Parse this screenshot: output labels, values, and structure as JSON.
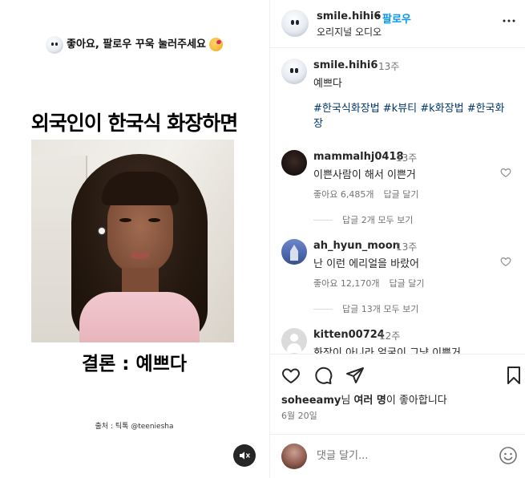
{
  "media": {
    "top_text": "좋아요, 팔로우 꾸욱 눌러주세요",
    "headline": "외국인이 한국식 화장하면",
    "conclusion": "결론 : 예쁘다",
    "source": "출처 : 틱톡 @teeniesha"
  },
  "post": {
    "username": "smile.hihi6",
    "separator": "•",
    "follow_label": "팔로우",
    "audio_label": "오리지널 오디오"
  },
  "caption": {
    "username": "smile.hihi6",
    "time": "13주",
    "text": "예쁘다",
    "hashtags": "#한국식화장법 #k뷰티 #k화장법 #한국화장"
  },
  "comments": [
    {
      "username": "mammalhj0418",
      "time": "13주",
      "text": "이쁜사람이 해서 이쁜거",
      "likes": "좋아요 6,485개",
      "reply": "답글 달기",
      "view_replies": "답글 2개 모두 보기"
    },
    {
      "username": "ah_hyun_moon",
      "time": "13주",
      "text": "난 이런 에리얼을 바랐어",
      "likes": "좋아요 12,170개",
      "reply": "답글 달기",
      "view_replies": "답글 13개 모두 보기"
    },
    {
      "username": "kitten00724",
      "time": "12주",
      "text": "화장이 아니라 얼굴이 그냥 이쁜거"
    }
  ],
  "likes_summary": {
    "user": "soheeamy",
    "suffix_1": "님 ",
    "others": "여러 명",
    "suffix_2": "이 좋아합니다"
  },
  "date": "6월 20일",
  "composer": {
    "placeholder": "댓글 달기..."
  },
  "icons": {
    "like": "heart-icon",
    "comment": "comment-bubble-icon",
    "share": "paper-plane-icon",
    "save": "bookmark-icon",
    "more": "more-dots-icon",
    "mute": "speaker-muted-icon",
    "emoji": "emoji-smile-icon"
  },
  "colors": {
    "follow": "#0095f6",
    "hashtag": "#00376b",
    "muted_text": "#737373",
    "text": "#262626"
  }
}
